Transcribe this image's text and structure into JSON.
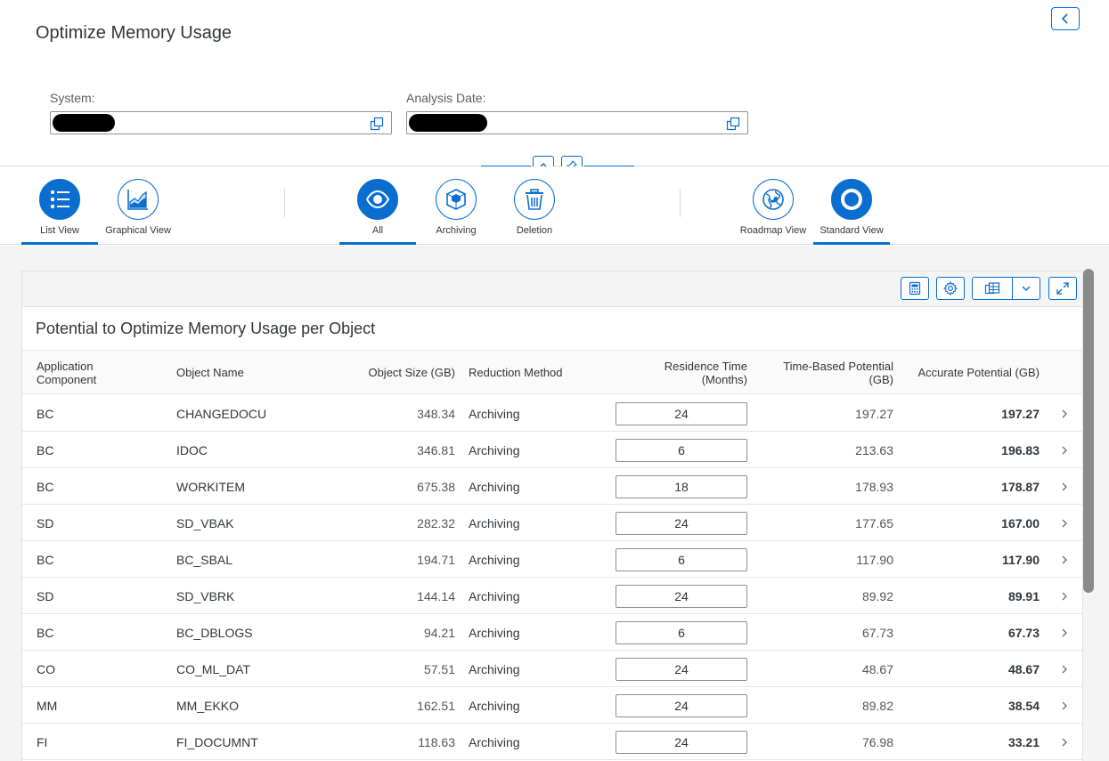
{
  "header": {
    "title": "Optimize Memory Usage",
    "fields": [
      {
        "label": "System:"
      },
      {
        "label": "Analysis Date:"
      }
    ]
  },
  "iconbar": {
    "view_tabs": [
      {
        "label": "List View",
        "icon": "list-icon",
        "selected": true
      },
      {
        "label": "Graphical View",
        "icon": "area-chart-icon",
        "selected": false
      }
    ],
    "filter_tabs": [
      {
        "label": "All",
        "icon": "eye-icon",
        "selected": true
      },
      {
        "label": "Archiving",
        "icon": "cube-icon",
        "selected": false
      },
      {
        "label": "Deletion",
        "icon": "trash-icon",
        "selected": false
      }
    ],
    "mode_tabs": [
      {
        "label": "Roadmap View",
        "icon": "globe-icon",
        "selected": false
      },
      {
        "label": "Standard View",
        "icon": "circle-icon",
        "selected": true
      }
    ]
  },
  "table": {
    "title": "Potential to Optimize Memory Usage per Object",
    "columns": {
      "component_l1": "Application",
      "component_l2": "Component",
      "object_name": "Object Name",
      "object_size": "Object Size (GB)",
      "method": "Reduction Method",
      "residence_l1": "Residence Time",
      "residence_l2": "(Months)",
      "time_potential_l1": "Time-Based Potential",
      "time_potential_l2": "(GB)",
      "accurate_potential": "Accurate Potential (GB)"
    },
    "rows": [
      {
        "component": "BC",
        "name": "CHANGEDOCU",
        "size": "348.34",
        "method": "Archiving",
        "residence": "24",
        "time_potential": "197.27",
        "accurate": "197.27"
      },
      {
        "component": "BC",
        "name": "IDOC",
        "size": "346.81",
        "method": "Archiving",
        "residence": "6",
        "time_potential": "213.63",
        "accurate": "196.83"
      },
      {
        "component": "BC",
        "name": "WORKITEM",
        "size": "675.38",
        "method": "Archiving",
        "residence": "18",
        "time_potential": "178.93",
        "accurate": "178.87"
      },
      {
        "component": "SD",
        "name": "SD_VBAK",
        "size": "282.32",
        "method": "Archiving",
        "residence": "24",
        "time_potential": "177.65",
        "accurate": "167.00"
      },
      {
        "component": "BC",
        "name": "BC_SBAL",
        "size": "194.71",
        "method": "Archiving",
        "residence": "6",
        "time_potential": "117.90",
        "accurate": "117.90"
      },
      {
        "component": "SD",
        "name": "SD_VBRK",
        "size": "144.14",
        "method": "Archiving",
        "residence": "24",
        "time_potential": "89.92",
        "accurate": "89.91"
      },
      {
        "component": "BC",
        "name": "BC_DBLOGS",
        "size": "94.21",
        "method": "Archiving",
        "residence": "6",
        "time_potential": "67.73",
        "accurate": "67.73"
      },
      {
        "component": "CO",
        "name": "CO_ML_DAT",
        "size": "57.51",
        "method": "Archiving",
        "residence": "24",
        "time_potential": "48.67",
        "accurate": "48.67"
      },
      {
        "component": "MM",
        "name": "MM_EKKO",
        "size": "162.51",
        "method": "Archiving",
        "residence": "24",
        "time_potential": "89.82",
        "accurate": "38.54"
      },
      {
        "component": "FI",
        "name": "FI_DOCUMNT",
        "size": "118.63",
        "method": "Archiving",
        "residence": "24",
        "time_potential": "76.98",
        "accurate": "33.21"
      }
    ]
  },
  "colors": {
    "accent": "#0a6ed1",
    "text": "#32363a",
    "background": "#f4f4f4"
  }
}
